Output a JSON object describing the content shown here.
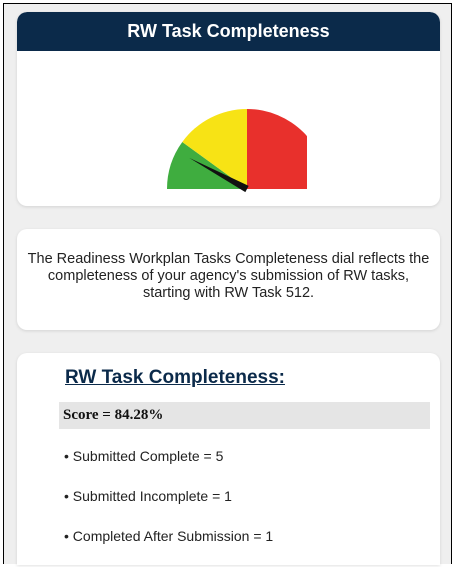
{
  "header": {
    "title": "RW Task Completeness"
  },
  "gauge": {
    "value_percent": 84.28,
    "colors": {
      "red": "#e8302c",
      "yellow": "#f7e315",
      "green": "#3fad3f",
      "needle": "#111111"
    }
  },
  "description": {
    "text": "The Readiness Workplan Tasks Completeness dial reflects the completeness of your agency's submission of RW tasks, starting with RW Task 512."
  },
  "stats": {
    "title": "RW Task Completeness:",
    "score": "Score = 84.28%",
    "items": [
      "• Submitted Complete = 5",
      "• Submitted Incomplete = 1",
      "• Completed After Submission = 1"
    ]
  }
}
